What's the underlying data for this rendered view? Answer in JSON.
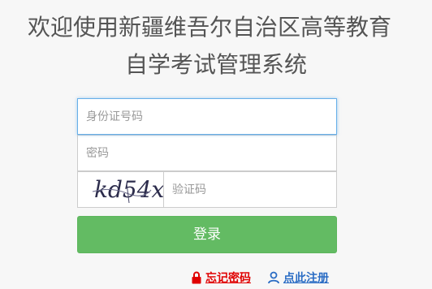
{
  "header": {
    "title_line1": "欢迎使用新疆维吾尔自治区高等教育",
    "title_line2": "自学考试管理系统"
  },
  "form": {
    "id_placeholder": "身份证号码",
    "password_placeholder": "密码",
    "captcha_placeholder": "验证码",
    "captcha_text": "kd54x",
    "login_label": "登录"
  },
  "links": {
    "forgot_password": "忘记密码",
    "register": "点此注册"
  },
  "colors": {
    "login_button": "#5cb85c",
    "forgot_link": "#e00000",
    "register_link": "#2a6cc4",
    "focus_border": "#66afe9"
  }
}
